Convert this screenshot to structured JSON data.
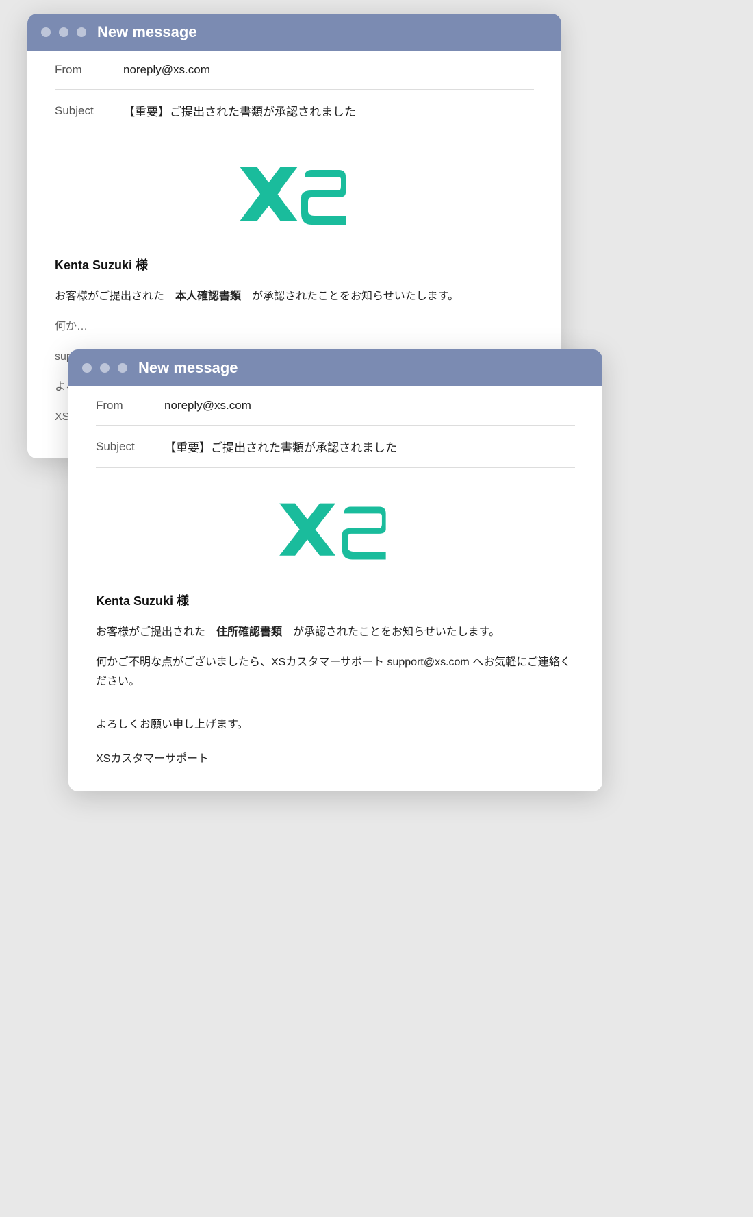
{
  "window1": {
    "title": "New message",
    "from_label": "From",
    "from_value": "noreply@xs.com",
    "subject_label": "Subject",
    "subject_value": "【重要】ご提出された書類が承認されました",
    "greeting": "Kenta Suzuki 様",
    "body1": "お客様がご提出された　本人確認書類　が承認されたことをお知らせいたします。",
    "body2_partial": "何か…",
    "support_partial": "sup…",
    "yoroshiku_partial": "よろ…",
    "xs_partial": "XSカ…"
  },
  "window2": {
    "title": "New message",
    "from_label": "From",
    "from_value": "noreply@xs.com",
    "subject_label": "Subject",
    "subject_value": "【重要】ご提出された書類が承認されました",
    "greeting": "Kenta Suzuki 様",
    "body1": "お客様がご提出された　住所確認書類　が承認されたことをお知らせいたします。",
    "body2": "何かご不明な点がございましたら、XSカスタマーサポート support@xs.com へお気軽にご連絡ください。",
    "yoroshiku": "よろしくお願い申し上げます。",
    "sign_off": "XSカスタマーサポート"
  }
}
